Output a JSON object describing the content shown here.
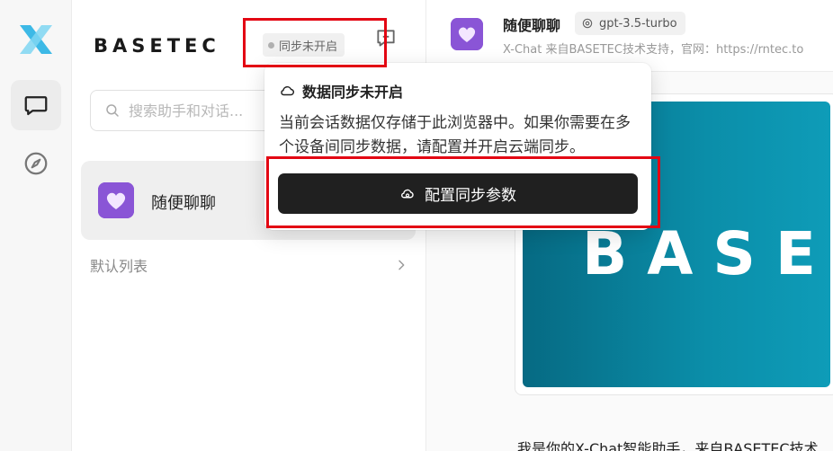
{
  "sidebar": {
    "brand": "BASETEC",
    "sync_badge": "同步未开启",
    "search_placeholder": "搜索助手和对话...",
    "session": {
      "title": "随便聊聊"
    },
    "default_list_label": "默认列表"
  },
  "header": {
    "title": "随便聊聊",
    "model": "gpt-3.5-turbo",
    "description": "X-Chat 来自BASETEC技术支持，官网：https://rntec.to"
  },
  "popover": {
    "title": "数据同步未开启",
    "body": "当前会话数据仅存储于此浏览器中。如果你需要在多个设备间同步数据，请配置并开启云端同步。",
    "button": "配置同步参数"
  },
  "banner_text": "BASETEC",
  "intro_text": "我是你的X-Chat智能助手，来自BASETEC技术",
  "colors": {
    "accent_dark": "#202020",
    "banner_teal": "#0b8ea9",
    "annotation_red": "#e30613"
  }
}
